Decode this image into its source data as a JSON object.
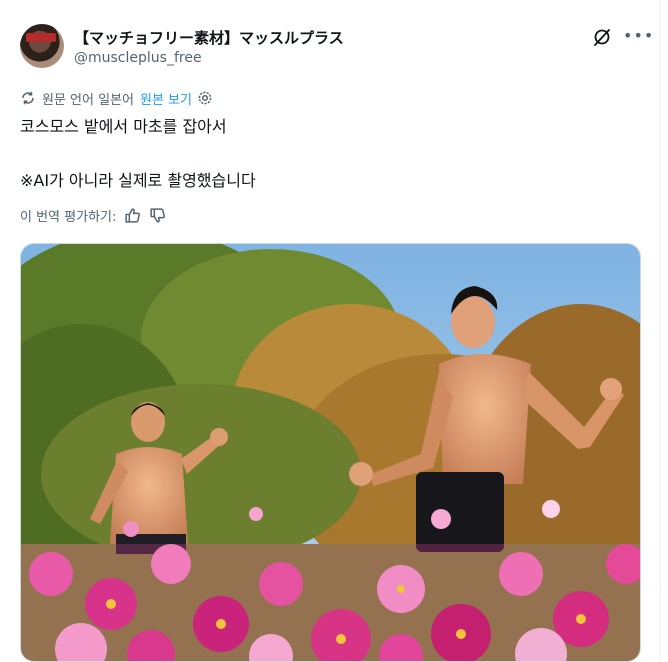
{
  "post": {
    "display_name": "【マッチョフリー素材】マッスルプラス",
    "handle": "@muscleplus_free",
    "translated_note": "원문 언어 일본어",
    "show_original": "원본 보기",
    "text_lines": [
      "코스모스 밭에서 마초를 잡아서",
      "※AI가 아니라 실제로 촬영했습니다"
    ],
    "rate_translation": "이 번역 평가하기:"
  },
  "icons": {
    "more": "more-horizontal-icon",
    "grok": "grok-icon",
    "translate": "translate-icon",
    "settings": "gear-icon",
    "like": "thumbs-up-icon",
    "dislike": "thumbs-down-icon"
  },
  "colors": {
    "link": "#1d9bf0",
    "secondary_text": "#536471",
    "text": "#0f1419"
  }
}
